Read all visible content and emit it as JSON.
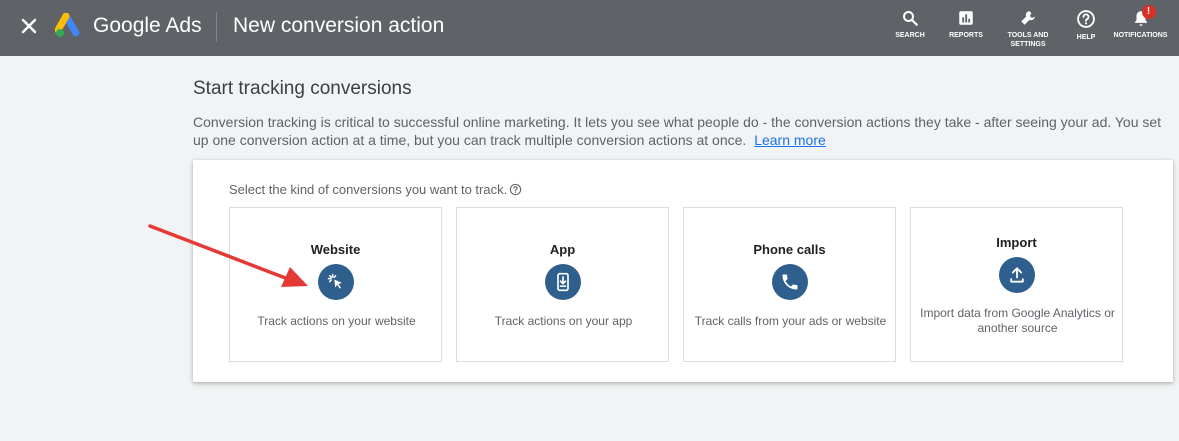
{
  "header": {
    "brand": "Google Ads",
    "page_title": "New conversion action",
    "tools": {
      "search": "SEARCH",
      "reports": "REPORTS",
      "tools_line1": "TOOLS AND",
      "tools_line2": "SETTINGS",
      "help": "HELP",
      "notifications": "NOTIFICATIONS",
      "notification_badge": "!"
    }
  },
  "main": {
    "heading": "Start tracking conversions",
    "intro": "Conversion tracking is critical to successful online marketing. It lets you see what people do - the conversion actions they take - after seeing your ad. You set up one conversion action at a time, but you can track multiple conversion actions at once.",
    "learn_more": "Learn more",
    "prompt": "Select the kind of conversions you want to track.",
    "cards": [
      {
        "title": "Website",
        "desc": "Track actions on your website",
        "icon": "cursor-click-icon"
      },
      {
        "title": "App",
        "desc": "Track actions on your app",
        "icon": "phone-download-icon"
      },
      {
        "title": "Phone calls",
        "desc": "Track calls from your ads or website",
        "icon": "phone-call-icon"
      },
      {
        "title": "Import",
        "desc": "Import data from Google Analytics or another source",
        "icon": "upload-icon"
      }
    ]
  },
  "colors": {
    "header_bg": "#5f6368",
    "icon_circle": "#2e5f8d",
    "link": "#1a73e8",
    "annotation_arrow": "#e53935",
    "badge": "#d93025"
  }
}
